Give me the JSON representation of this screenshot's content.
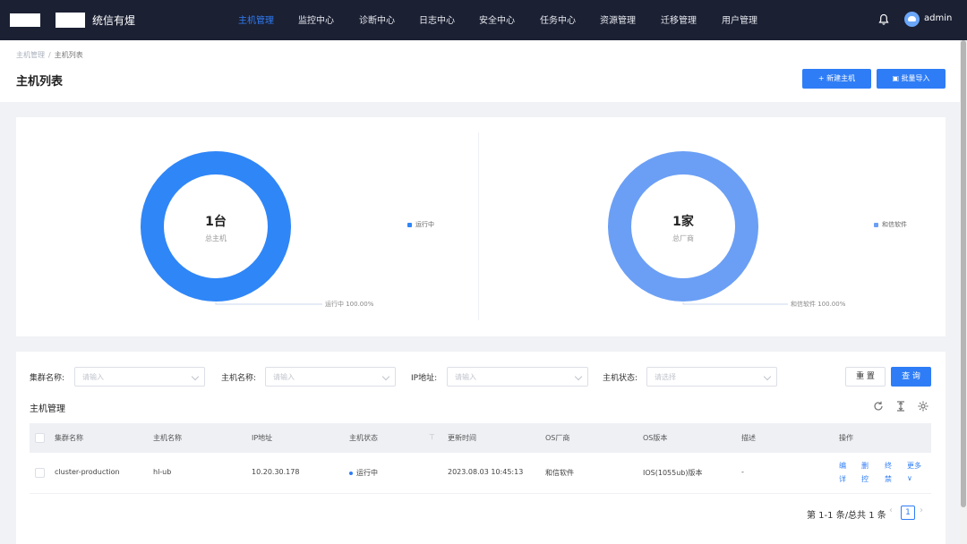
{
  "app": {
    "title": "统信有煋"
  },
  "nav": {
    "items": [
      {
        "label": "主机管理",
        "active": true
      },
      {
        "label": "监控中心",
        "active": false
      },
      {
        "label": "诊断中心",
        "active": false
      },
      {
        "label": "日志中心",
        "active": false
      },
      {
        "label": "安全中心",
        "active": false
      },
      {
        "label": "任务中心",
        "active": false
      },
      {
        "label": "资源管理",
        "active": false
      },
      {
        "label": "迁移管理",
        "active": false
      },
      {
        "label": "用户管理",
        "active": false
      }
    ],
    "user": "admin"
  },
  "page": {
    "breadcrumb": [
      "主机管理",
      "主机列表"
    ],
    "title": "主机列表",
    "new_button": "+ 新建主机",
    "import_button": "批量导入"
  },
  "stats": {
    "left": {
      "center_num": "1台",
      "center_sub": "总主机",
      "legend": "运行中",
      "leader": "运行中 100.00%",
      "color": "#2f86f7"
    },
    "right": {
      "center_num": "1家",
      "center_sub": "总厂商",
      "legend": "和信软件",
      "leader": "和信软件 100.00%",
      "color": "#6b9ff5"
    }
  },
  "filters": {
    "items": [
      {
        "label": "集群名称:",
        "placeholder": "请输入"
      },
      {
        "label": "主机名称:",
        "placeholder": "请输入"
      },
      {
        "label": "IP地址:",
        "placeholder": "请输入"
      },
      {
        "label": "主机状态:",
        "placeholder": "请选择"
      }
    ],
    "reset": "重 置",
    "query": "查 询"
  },
  "table": {
    "section_title": "主机管理",
    "columns": [
      "集群名称",
      "主机名称",
      "IP地址",
      "主机状态",
      "更新时间",
      "OS厂商",
      "OS版本",
      "描述",
      "操作"
    ],
    "rows": [
      {
        "cluster": "cluster-production",
        "host": "hl-ub",
        "ip": "10.20.30.178",
        "status": "运行中",
        "updated": "2023.08.03 10:45:13",
        "os_vendor": "和信软件",
        "os_version": "IOS(1055ub)版本",
        "desc": "-",
        "ops": [
          "编",
          "删",
          "终",
          "更多",
          "详",
          "控",
          "禁",
          "∨"
        ]
      }
    ]
  },
  "pagination": {
    "summary": "第 1-1 条/总共 1 条",
    "current": "1",
    "prev": "‹",
    "next": "›"
  },
  "icons": {
    "bell": "bell-icon",
    "refresh": "refresh-icon",
    "height": "column-height-icon",
    "settings": "settings-icon"
  }
}
